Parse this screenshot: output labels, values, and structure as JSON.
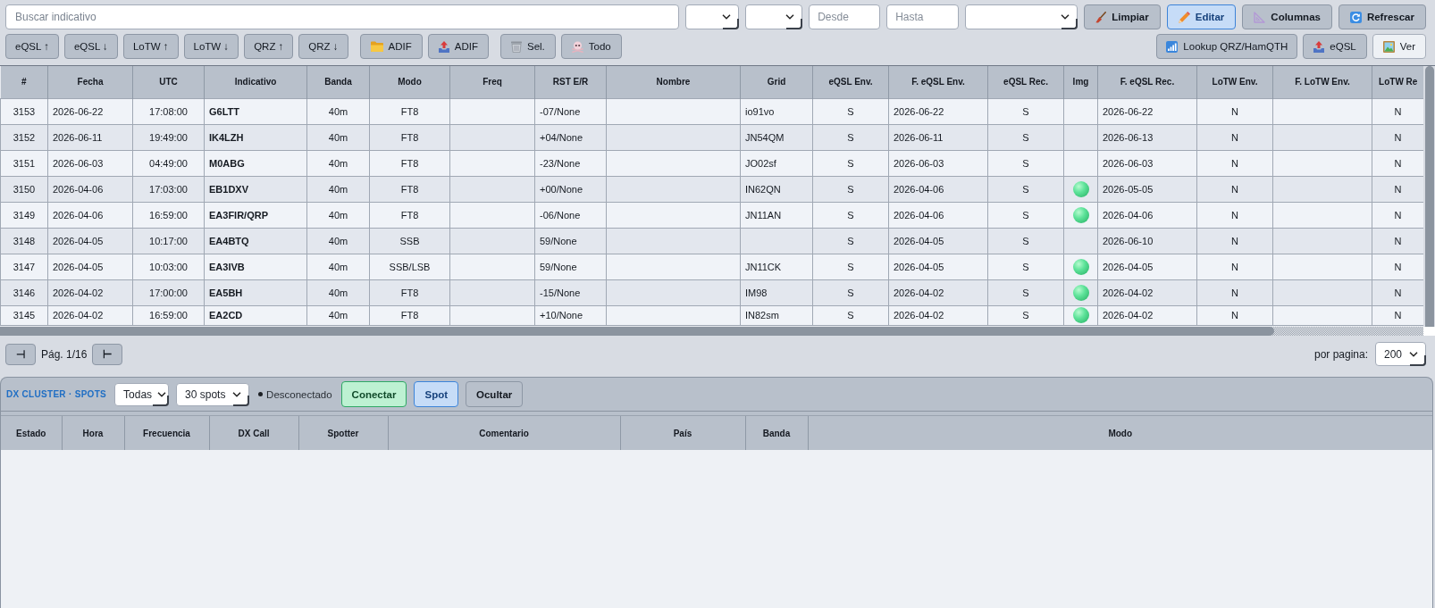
{
  "search": {
    "placeholder": "Buscar indicativo"
  },
  "filters": [
    {
      "kind": "select"
    },
    {
      "kind": "select"
    },
    {
      "kind": "input",
      "placeholder": "Desde"
    },
    {
      "kind": "input",
      "placeholder": "Hasta"
    },
    {
      "kind": "select"
    }
  ],
  "toolbar": {
    "clear_button": "Limpiar",
    "edit_button": {
      "label": "Editar",
      "on": true
    },
    "columns_button": "Columnas",
    "refresh_button": "Refrescar"
  },
  "actions": {
    "sync_buttons": [
      "eQSL ↑",
      "eQSL ↓",
      "LoTW ↑",
      "LoTW ↓",
      "QRZ ↑",
      "QRZ ↓"
    ],
    "adif_import_button": "ADIF",
    "adif_export_button": "ADIF",
    "delete_selected_button": "Sel.",
    "delete_all_button": "Todo",
    "lookup_button": "Lookup QRZ/HamQTH",
    "eqsl_button": "eQSL",
    "view_button": "Ver"
  },
  "table": {
    "columns": [
      "#",
      "Fecha",
      "UTC",
      "Indicativo",
      "Banda",
      "Modo",
      "Freq",
      "RST E/R",
      "Nombre",
      "Grid",
      "eQSL Env.",
      "F. eQSL Env.",
      "eQSL Rec.",
      "Img",
      "F. eQSL Rec.",
      "LoTW Env.",
      "F. LoTW Env.",
      "LoTW Re"
    ],
    "rows": [
      {
        "num": "3153",
        "date": "2026-06-22",
        "utc": "17:08:00",
        "call": "G6LTT",
        "band": "40m",
        "mode": "FT8",
        "rst": "-07/None",
        "grid": "io91vo",
        "eqsl_sent": "S",
        "eqsl_sent_date": "2026-06-22",
        "eqsl_rcvd": "S",
        "img": false,
        "eqsl_rcvd_date": "2026-06-22",
        "lotw_sent": "N",
        "lotw_rcvd": "N"
      },
      {
        "num": "3152",
        "date": "2026-06-11",
        "utc": "19:49:00",
        "call": "IK4LZH",
        "band": "40m",
        "mode": "FT8",
        "rst": "+04/None",
        "grid": "JN54QM",
        "eqsl_sent": "S",
        "eqsl_sent_date": "2026-06-11",
        "eqsl_rcvd": "S",
        "img": false,
        "eqsl_rcvd_date": "2026-06-13",
        "lotw_sent": "N",
        "lotw_rcvd": "N"
      },
      {
        "num": "3151",
        "date": "2026-06-03",
        "utc": "04:49:00",
        "call": "M0ABG",
        "band": "40m",
        "mode": "FT8",
        "rst": "-23/None",
        "grid": "JO02sf",
        "eqsl_sent": "S",
        "eqsl_sent_date": "2026-06-03",
        "eqsl_rcvd": "S",
        "img": false,
        "eqsl_rcvd_date": "2026-06-03",
        "lotw_sent": "N",
        "lotw_rcvd": "N"
      },
      {
        "num": "3150",
        "date": "2026-04-06",
        "utc": "17:03:00",
        "call": "EB1DXV",
        "band": "40m",
        "mode": "FT8",
        "rst": "+00/None",
        "grid": "IN62QN",
        "eqsl_sent": "S",
        "eqsl_sent_date": "2026-04-06",
        "eqsl_rcvd": "S",
        "img": true,
        "eqsl_rcvd_date": "2026-05-05",
        "lotw_sent": "N",
        "lotw_rcvd": "N"
      },
      {
        "num": "3149",
        "date": "2026-04-06",
        "utc": "16:59:00",
        "call": "EA3FIR/QRP",
        "band": "40m",
        "mode": "FT8",
        "rst": "-06/None",
        "grid": "JN11AN",
        "eqsl_sent": "S",
        "eqsl_sent_date": "2026-04-06",
        "eqsl_rcvd": "S",
        "img": true,
        "eqsl_rcvd_date": "2026-04-06",
        "lotw_sent": "N",
        "lotw_rcvd": "N"
      },
      {
        "num": "3148",
        "date": "2026-04-05",
        "utc": "10:17:00",
        "call": "EA4BTQ",
        "band": "40m",
        "mode": "SSB",
        "rst": "59/None",
        "eqsl_sent": "S",
        "eqsl_sent_date": "2026-04-05",
        "eqsl_rcvd": "S",
        "img": false,
        "eqsl_rcvd_date": "2026-06-10",
        "lotw_sent": "N",
        "lotw_rcvd": "N"
      },
      {
        "num": "3147",
        "date": "2026-04-05",
        "utc": "10:03:00",
        "call": "EA3IVB",
        "band": "40m",
        "mode": "SSB/LSB",
        "rst": "59/None",
        "grid": "JN11CK",
        "eqsl_sent": "S",
        "eqsl_sent_date": "2026-04-05",
        "eqsl_rcvd": "S",
        "img": true,
        "eqsl_rcvd_date": "2026-04-05",
        "lotw_sent": "N",
        "lotw_rcvd": "N"
      },
      {
        "num": "3146",
        "date": "2026-04-02",
        "utc": "17:00:00",
        "call": "EA5BH",
        "band": "40m",
        "mode": "FT8",
        "rst": "-15/None",
        "grid": "IM98",
        "eqsl_sent": "S",
        "eqsl_sent_date": "2026-04-02",
        "eqsl_rcvd": "S",
        "img": true,
        "eqsl_rcvd_date": "2026-04-02",
        "lotw_sent": "N",
        "lotw_rcvd": "N"
      },
      {
        "num": "3145",
        "date": "2026-04-02",
        "utc": "16:59:00",
        "call": "EA2CD",
        "band": "40m",
        "mode": "FT8",
        "rst": "+10/None",
        "grid": "IN82sm",
        "eqsl_sent": "S",
        "eqsl_sent_date": "2026-04-02",
        "eqsl_rcvd": "S",
        "img": true,
        "eqsl_rcvd_date": "2026-04-02",
        "lotw_sent": "N",
        "lotw_rcvd": "N"
      }
    ]
  },
  "pagination": {
    "previous_button": "⊣",
    "page": "Pág. 1/16",
    "next_button": "⊢",
    "per_page_label": "por pagina:",
    "per_page": "200"
  },
  "cluster": {
    "title": "DX CLUSTER · SPOTS",
    "band_filter": "Todas",
    "spot_limit": "30 spots",
    "connected": false,
    "status": "Desconectado",
    "connect_button": "Conectar",
    "spot_button": "Spot",
    "hide_button": "Ocultar",
    "columns": [
      "Estado",
      "Hora",
      "Frecuencia",
      "DX Call",
      "Spotter",
      "Comentario",
      "País",
      "Banda",
      "Modo"
    ]
  }
}
